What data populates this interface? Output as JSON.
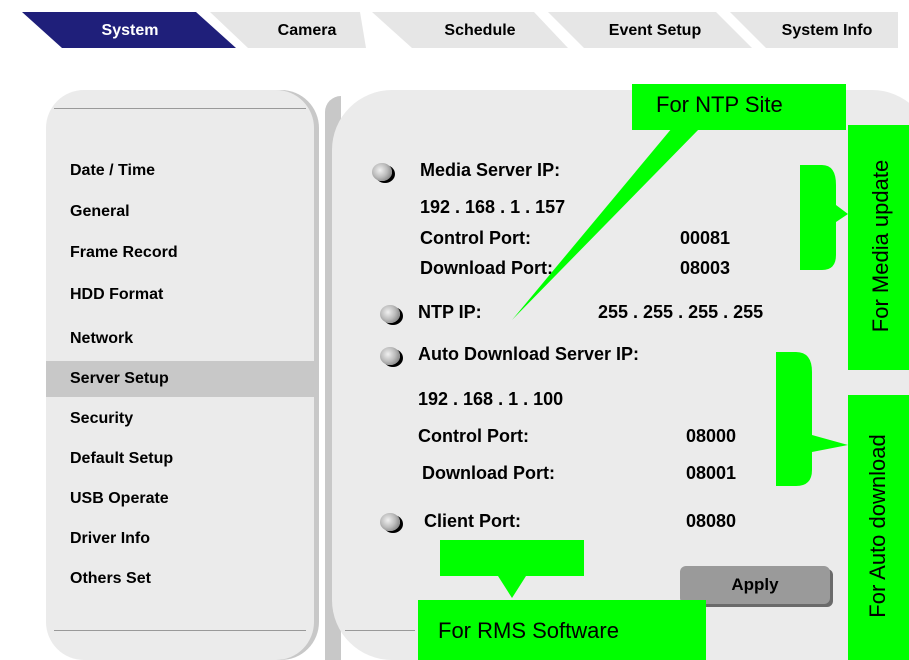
{
  "tabs": [
    {
      "label": "System",
      "active": true
    },
    {
      "label": "Camera",
      "active": false
    },
    {
      "label": "Schedule",
      "active": false
    },
    {
      "label": "Event Setup",
      "active": false
    },
    {
      "label": "System Info",
      "active": false
    }
  ],
  "sidebar": {
    "items": [
      {
        "label": "Date / Time"
      },
      {
        "label": "General"
      },
      {
        "label": "Frame Record"
      },
      {
        "label": "HDD Format"
      },
      {
        "label": "Network"
      },
      {
        "label": "Server Setup",
        "selected": true
      },
      {
        "label": "Security"
      },
      {
        "label": "Default Setup"
      },
      {
        "label": "USB Operate"
      },
      {
        "label": "Driver Info"
      },
      {
        "label": "Others Set"
      }
    ]
  },
  "server_setup": {
    "media_server_label": "Media Server IP:",
    "media_server_ip": "192 . 168 . 1 . 157",
    "media_control_port_label": "Control Port:",
    "media_control_port": "00081",
    "media_download_port_label": "Download Port:",
    "media_download_port": "08003",
    "ntp_label": "NTP IP:",
    "ntp_ip": "255 . 255 . 255 . 255",
    "auto_download_label": "Auto Download Server IP:",
    "auto_download_ip": "192 . 168 . 1 . 100",
    "auto_control_port_label": "Control Port:",
    "auto_control_port": "08000",
    "auto_download_port_label": "Download Port:",
    "auto_download_port": "08001",
    "client_port_label": "Client Port:",
    "client_port": "08080",
    "apply_label": "Apply"
  },
  "callouts": {
    "ntp_site": "For NTP Site",
    "media_update": "For Media update",
    "auto_download": "For Auto download",
    "rms_software": "For RMS Software"
  },
  "colors": {
    "active_tab": "#1f1f7a",
    "inactive_tab": "#e8e8e8",
    "panel": "#ebebeb",
    "selected_item": "#c8c8c8",
    "callout": "#00ff00"
  }
}
